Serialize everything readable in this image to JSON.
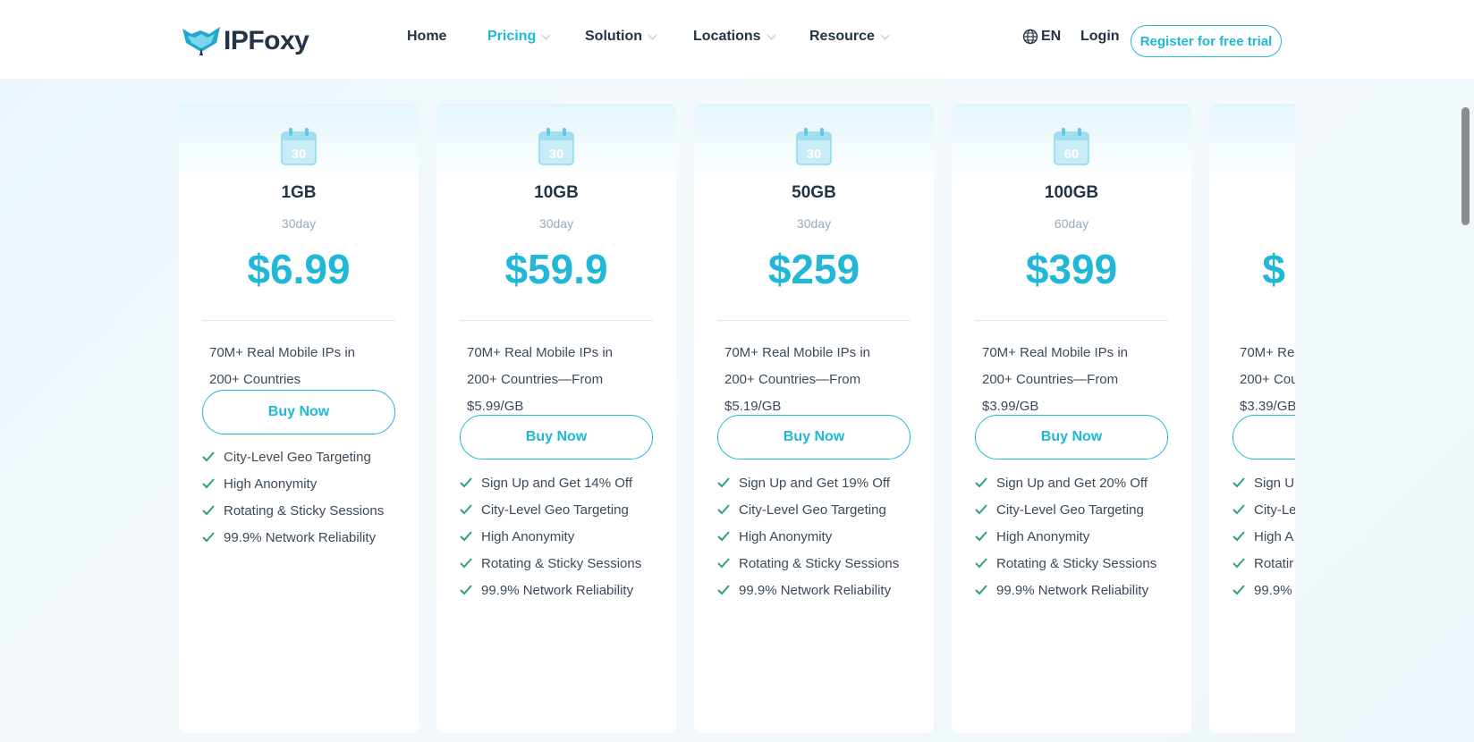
{
  "header": {
    "logo_text": "IPFoxy",
    "nav": [
      {
        "label": "Home",
        "dropdown": false,
        "active": false
      },
      {
        "label": "Pricing",
        "dropdown": true,
        "active": true
      },
      {
        "label": "Solution",
        "dropdown": true,
        "active": false
      },
      {
        "label": "Locations",
        "dropdown": true,
        "active": false
      },
      {
        "label": "Resource",
        "dropdown": true,
        "active": false
      }
    ],
    "language": "EN",
    "login": "Login",
    "register": "Register for free trial"
  },
  "plans": [
    {
      "calendar_number": "30",
      "size": "1GB",
      "duration": "30day",
      "price": "$6.99",
      "description": [
        "70M+ Real Mobile IPs in",
        "200+ Countries"
      ],
      "button": "Buy Now",
      "features": [
        "City-Level Geo Targeting",
        "High Anonymity",
        "Rotating & Sticky Sessions",
        "99.9% Network Reliability"
      ]
    },
    {
      "calendar_number": "30",
      "size": "10GB",
      "duration": "30day",
      "price": "$59.9",
      "description": [
        "70M+ Real Mobile IPs in",
        "200+ Countries—From",
        "$5.99/GB"
      ],
      "button": "Buy Now",
      "features": [
        "Sign Up and Get 14% Off",
        "City-Level Geo Targeting",
        "High Anonymity",
        "Rotating & Sticky Sessions",
        "99.9% Network Reliability"
      ]
    },
    {
      "calendar_number": "30",
      "size": "50GB",
      "duration": "30day",
      "price": "$259",
      "description": [
        "70M+ Real Mobile IPs in",
        "200+ Countries—From",
        "$5.19/GB"
      ],
      "button": "Buy Now",
      "features": [
        "Sign Up and Get 19% Off",
        "City-Level Geo Targeting",
        "High Anonymity",
        "Rotating & Sticky Sessions",
        "99.9% Network Reliability"
      ]
    },
    {
      "calendar_number": "60",
      "size": "100GB",
      "duration": "60day",
      "price": "$399",
      "description": [
        "70M+ Real Mobile IPs in",
        "200+ Countries—From",
        "$3.99/GB"
      ],
      "button": "Buy Now",
      "features": [
        "Sign Up and Get 20% Off",
        "City-Level Geo Targeting",
        "High Anonymity",
        "Rotating & Sticky Sessions",
        "99.9% Network Reliability"
      ]
    },
    {
      "calendar_number": "",
      "size": "",
      "duration": "",
      "price": "$",
      "description": [
        "70M+ Re",
        "200+ Cou",
        "$3.39/GB"
      ],
      "button": "",
      "features": [
        "Sign U",
        "City-Le",
        "High A",
        "Rotatir",
        "99.9%"
      ]
    }
  ],
  "colors": {
    "accent": "#20b8d6",
    "check": "#2fa36b",
    "heading": "#243447"
  }
}
